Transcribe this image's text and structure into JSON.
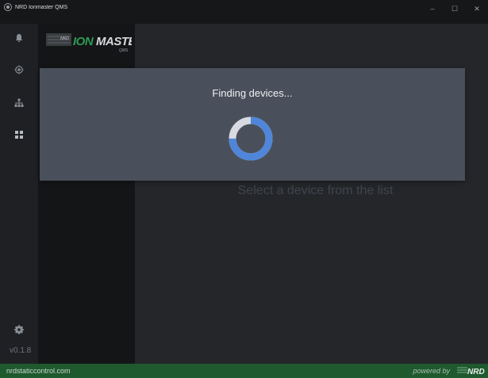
{
  "window": {
    "title": "NRD Ionmaster QMS",
    "controls": {
      "minimize": "–",
      "maximize": "☐",
      "close": "✕"
    }
  },
  "sidebar": {
    "icons": [
      "bell-icon",
      "target-icon",
      "network-icon",
      "grid-icon"
    ],
    "settings_icon": "gear-icon",
    "version": "v0.1.8"
  },
  "logo": {
    "small": "NRD",
    "main": "IONMASTER",
    "sub": "QMS"
  },
  "main": {
    "empty_message": "Select a device from the list"
  },
  "loading": {
    "message": "Finding devices...",
    "progress": 0.75
  },
  "footer": {
    "link": "nrdstaticcontrol.com",
    "powered_by": "powered by",
    "brand": "NRD"
  },
  "colors": {
    "accent": "#4f86d9",
    "footer": "#1e5a2e",
    "overlay": "#4a505b"
  }
}
